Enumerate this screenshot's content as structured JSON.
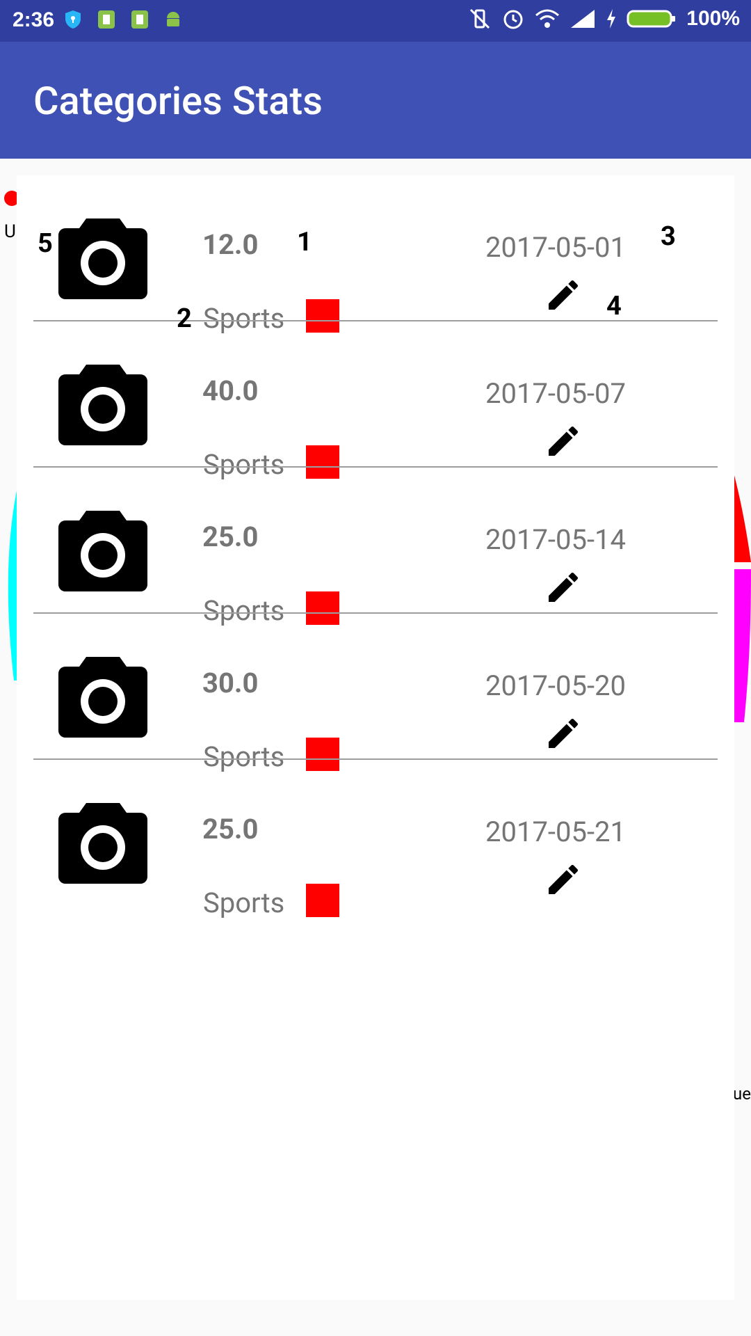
{
  "status_bar": {
    "time": "2:36",
    "battery_percent": "100%",
    "left_icons": [
      "shield-icon",
      "sim-card-icon",
      "sim-card-icon",
      "android-icon"
    ],
    "right_icons": [
      "vibrate-mute-icon",
      "alarm-icon",
      "wifi-icon",
      "signal-icon",
      "charging-icon",
      "battery-icon"
    ]
  },
  "app_bar": {
    "title": "Categories Stats"
  },
  "background": {
    "legend_letter": "U",
    "legend_tail": "ue"
  },
  "annotations": {
    "a1": "1",
    "a2": "2",
    "a3": "3",
    "a4": "4",
    "a5": "5"
  },
  "colors": {
    "primary": "#3f51b5",
    "primary_dark": "#303f9f",
    "category_color": "#ff0000"
  },
  "expenses": [
    {
      "amount": "12.0",
      "category": "Sports",
      "date": "2017-05-01"
    },
    {
      "amount": "40.0",
      "category": "Sports",
      "date": "2017-05-07"
    },
    {
      "amount": "25.0",
      "category": "Sports",
      "date": "2017-05-14"
    },
    {
      "amount": "30.0",
      "category": "Sports",
      "date": "2017-05-20"
    },
    {
      "amount": "25.0",
      "category": "Sports",
      "date": "2017-05-21"
    }
  ]
}
